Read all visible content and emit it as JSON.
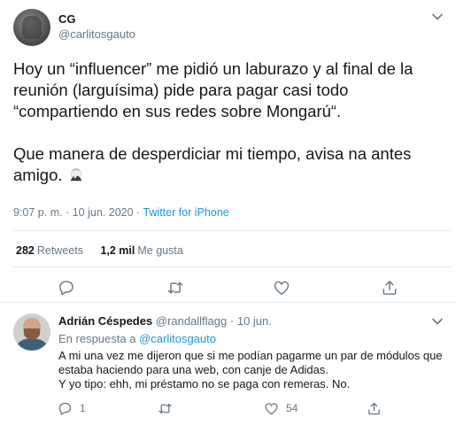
{
  "tweet": {
    "name": "CG",
    "handle": "@carlitosgauto",
    "paragraph1": "Hoy un “influencer” me pidió un laburazo y al final de la reunión (larguísima) pide para pagar casi todo “compartiendo en sus redes sobre Mongarú“.",
    "paragraph2": "Que manera de desperdiciar mi tiempo, avisa na antes amigo.",
    "emoji_icon": "face-palm-icon",
    "time": "9:07 p. m.",
    "separator": "·",
    "date": "10 jun. 2020",
    "source": "Twitter for iPhone",
    "retweets_count": "282",
    "retweets_label": "Retweets",
    "likes_count": "1,2 mil",
    "likes_label": "Me gusta",
    "action_icons": [
      "reply-icon",
      "retweet-icon",
      "like-icon",
      "share-icon"
    ]
  },
  "reply": {
    "name": "Adrián Céspedes",
    "handle": "@randallflagg",
    "dot": "·",
    "date": "10 jun.",
    "in_reply_prefix": "En respuesta a",
    "in_reply_mention": "@carlitosgauto",
    "text_line1": "A mi una vez me dijeron que si me podían pagarme un par de módulos que estaba haciendo para una web,  con canje de Adidas.",
    "text_line2": "Y yo tipo: ehh, mi préstamo no se paga con remeras. No.",
    "reply_count": "1",
    "retweet_count": "",
    "like_count": "54"
  },
  "colors": {
    "accent": "#1b95e0",
    "muted": "#657786",
    "text": "#14171a",
    "divider": "#e6ecf0"
  }
}
